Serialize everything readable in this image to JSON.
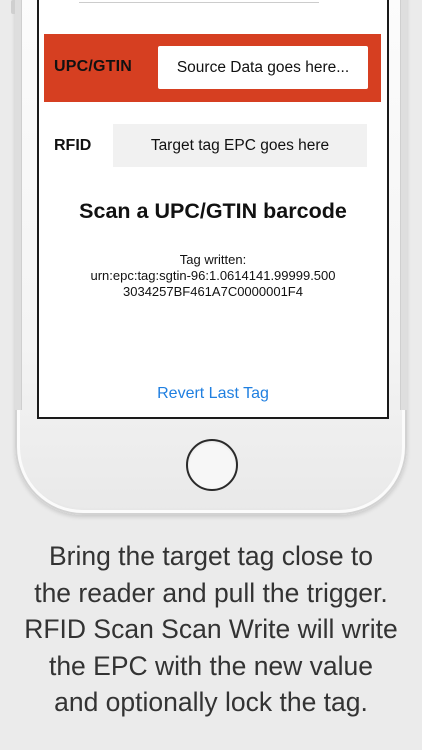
{
  "app": {
    "upc_label": "UPC/GTIN",
    "source_placeholder": "Source Data goes here...",
    "rfid_label": "RFID",
    "target_placeholder": "Target tag EPC goes here",
    "scan_title": "Scan a UPC/GTIN barcode",
    "tag_written_lines": [
      "Tag written:",
      "urn:epc:tag:sgtin-96:1.0614141.99999.500",
      "3034257BF461A7C0000001F4"
    ],
    "revert_label": "Revert Last Tag"
  },
  "caption": {
    "lines": [
      "Bring the target tag close to",
      "the reader and pull the trigger.",
      "RFID Scan Scan Write will write",
      "the EPC with the new value",
      "and optionally lock the tag."
    ]
  },
  "colors": {
    "upc_row": "#d63f21",
    "link": "#1f7fe0",
    "background": "#ebebeb"
  },
  "icons": {
    "home_button": "home-button-icon"
  }
}
